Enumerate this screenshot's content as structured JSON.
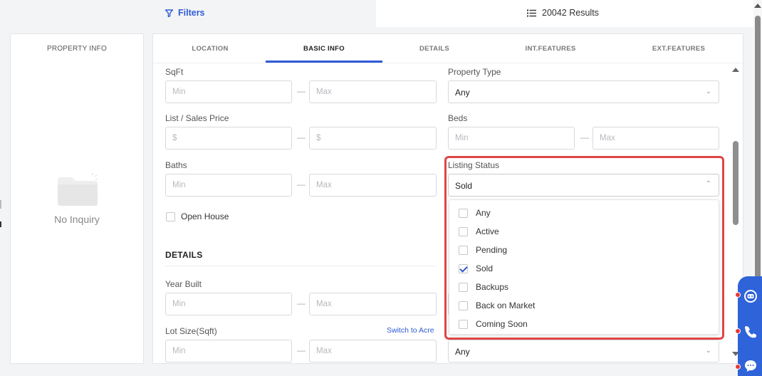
{
  "topbar": {
    "filters_label": "Filters",
    "results_label": "20042 Results"
  },
  "left_panel": {
    "title": "PROPERTY INFO",
    "empty_text": "No Inquiry"
  },
  "tabs": [
    {
      "label": "LOCATION"
    },
    {
      "label": "BASIC INFO"
    },
    {
      "label": "DETAILS"
    },
    {
      "label": "INT.FEATURES"
    },
    {
      "label": "EXT.FEATURES"
    }
  ],
  "active_tab": "BASIC INFO",
  "form": {
    "sqft": {
      "label": "SqFt",
      "min_placeholder": "Min",
      "max_placeholder": "Max"
    },
    "property_type": {
      "label": "Property Type",
      "value": "Any"
    },
    "price": {
      "label": "List / Sales Price",
      "min_placeholder": "$",
      "max_placeholder": "$"
    },
    "beds": {
      "label": "Beds",
      "min_placeholder": "Min",
      "max_placeholder": "Max"
    },
    "baths": {
      "label": "Baths",
      "min_placeholder": "Min",
      "max_placeholder": "Max"
    },
    "listing_status": {
      "label": "Listing Status",
      "value": "Sold"
    },
    "open_house": {
      "label": "Open House"
    },
    "details_section": "DETAILS",
    "year_built": {
      "label": "Year Built",
      "min_placeholder": "Min",
      "max_placeholder": "Max"
    },
    "lot_size": {
      "label": "Lot Size(Sqft)",
      "min_placeholder": "Min",
      "max_placeholder": "Max",
      "switch_link": "Switch to Acre"
    },
    "bottom_select": {
      "value": "Any"
    },
    "dash": "—"
  },
  "listing_status_options": [
    {
      "label": "Any",
      "checked": false
    },
    {
      "label": "Active",
      "checked": false
    },
    {
      "label": "Pending",
      "checked": false
    },
    {
      "label": "Sold",
      "checked": true
    },
    {
      "label": "Backups",
      "checked": false
    },
    {
      "label": "Back on Market",
      "checked": false
    },
    {
      "label": "Coming Soon",
      "checked": false
    }
  ],
  "colors": {
    "accent": "#2f5bd6",
    "highlight": "#e04545",
    "widget": "#2f63d9"
  },
  "icons": {
    "filters": "filter-icon",
    "results": "list-icon",
    "empty": "folder-icon",
    "chat": "chatbot-icon",
    "phone": "phone-icon",
    "message": "message-icon"
  }
}
